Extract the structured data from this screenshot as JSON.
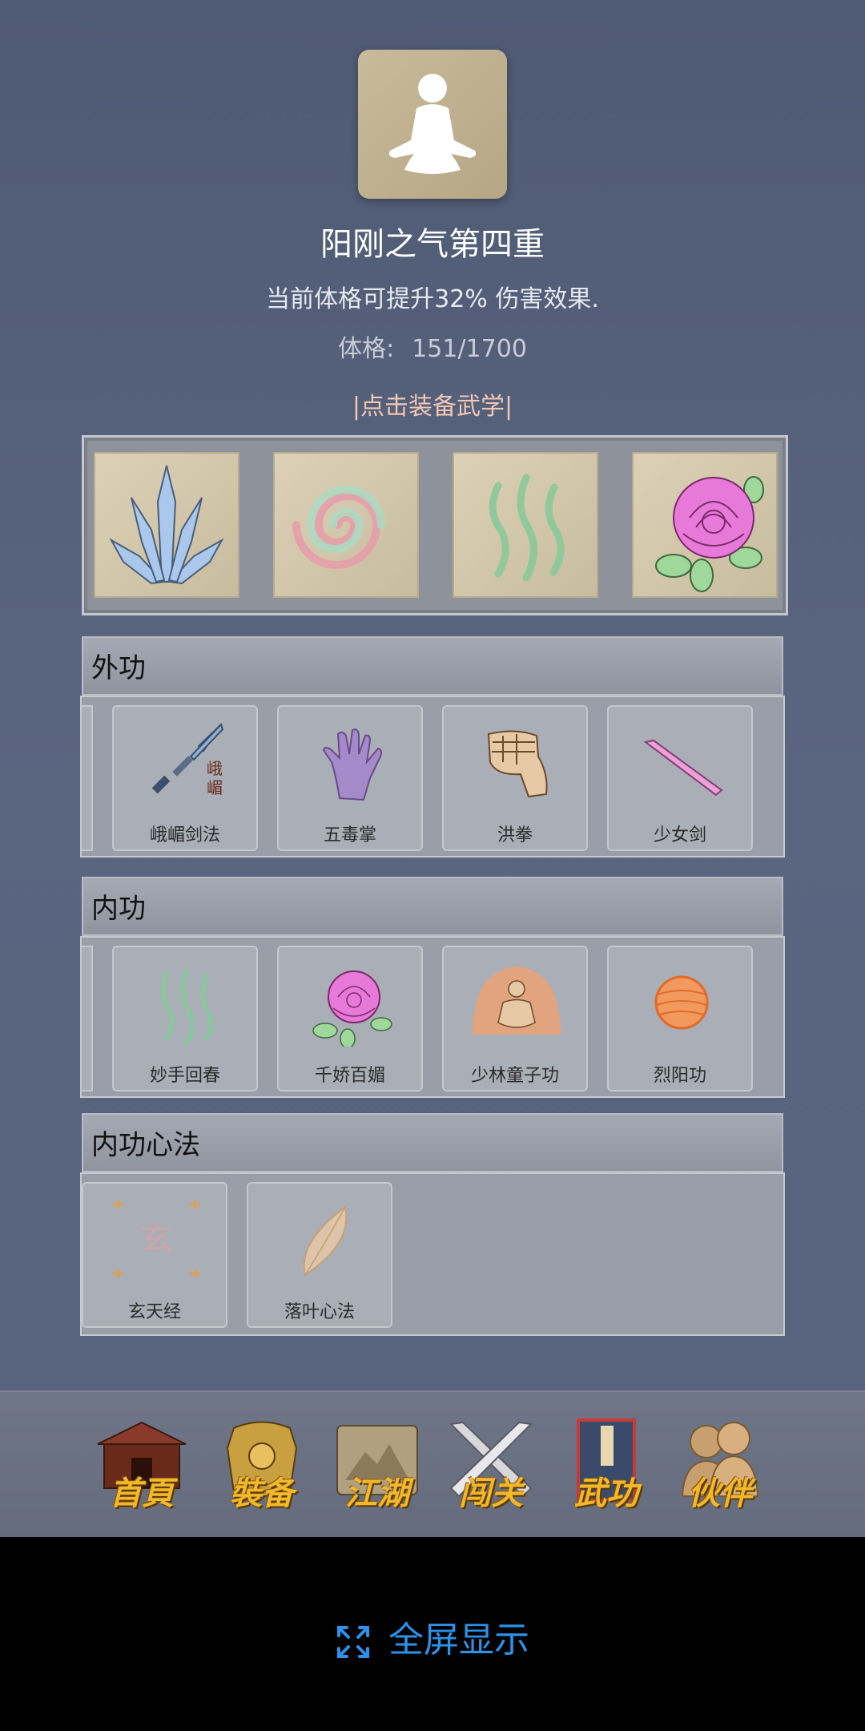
{
  "header": {
    "title": "阳刚之气第四重",
    "description": "当前体格可提升32% 伤害效果.",
    "stat_label": "体格:",
    "stat_value": "151/1700",
    "equip_hint": "|点击装备武学|"
  },
  "equipped": [
    {
      "icon": "crystal-blades-icon"
    },
    {
      "icon": "pink-swirl-icon"
    },
    {
      "icon": "green-wisps-icon"
    },
    {
      "icon": "pink-rose-icon"
    }
  ],
  "sections": {
    "outer": {
      "title": "外功",
      "items": [
        {
          "name": "峨嵋剑法",
          "icon": "sword-icon",
          "icon_text": "峨嵋"
        },
        {
          "name": "五毒掌",
          "icon": "purple-palm-icon"
        },
        {
          "name": "洪拳",
          "icon": "fist-icon"
        },
        {
          "name": "少女剑",
          "icon": "pink-sword-icon"
        }
      ]
    },
    "inner": {
      "title": "内功",
      "items": [
        {
          "name": "妙手回春",
          "icon": "green-wisps-icon"
        },
        {
          "name": "千娇百媚",
          "icon": "pink-rose-icon"
        },
        {
          "name": "少林童子功",
          "icon": "meditating-monk-icon"
        },
        {
          "name": "烈阳功",
          "icon": "orange-orb-icon"
        }
      ]
    },
    "mind": {
      "title": "内功心法",
      "items": [
        {
          "name": "玄天经",
          "icon": "xuan-seal-icon",
          "icon_text": "玄"
        },
        {
          "name": "落叶心法",
          "icon": "leaf-icon"
        }
      ]
    }
  },
  "nav": [
    {
      "label": "首頁",
      "icon": "house-icon"
    },
    {
      "label": "裝备",
      "icon": "armor-icon"
    },
    {
      "label": "江湖",
      "icon": "scroll-map-icon"
    },
    {
      "label": "闯关",
      "icon": "crossed-swords-icon"
    },
    {
      "label": "武功",
      "icon": "martial-book-icon",
      "active": true
    },
    {
      "label": "伙伴",
      "icon": "companions-icon"
    }
  ],
  "footer": {
    "fullscreen_label": "全屏显示",
    "icon": "expand-icon"
  }
}
